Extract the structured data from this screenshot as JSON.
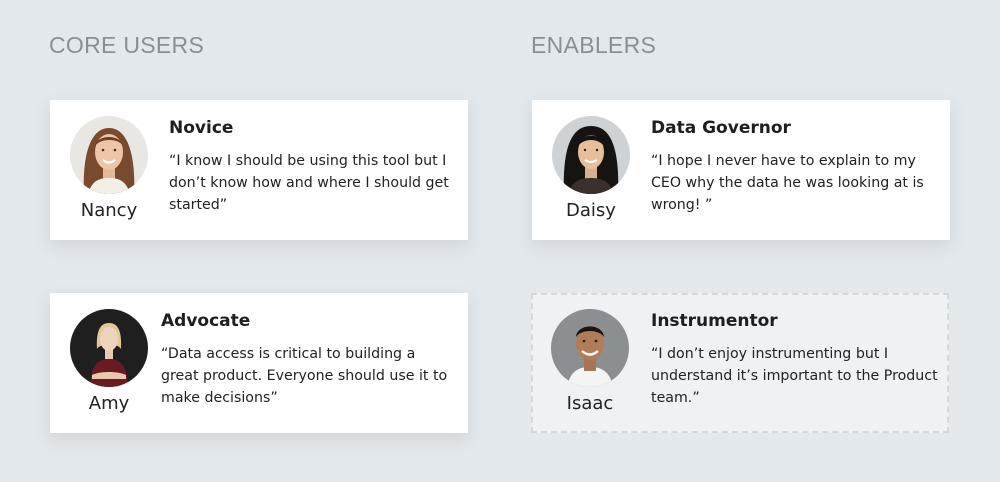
{
  "sections": {
    "core_users": "CORE USERS",
    "enablers": "ENABLERS"
  },
  "personas": [
    {
      "name": "Nancy",
      "role": "Novice",
      "quote": "“I know I should be using this tool but I don’t know how and where I should get started”"
    },
    {
      "name": "Amy",
      "role": "Advocate",
      "quote": "“Data access is critical to building a great product. Everyone should use it to make decisions”"
    },
    {
      "name": "Daisy",
      "role": "Data Governor",
      "quote": "“I hope I never have to explain to my CEO why the data he was looking at is wrong! ”"
    },
    {
      "name": "Isaac",
      "role": "Instrumentor",
      "quote": "“I don’t enjoy instrumenting but I understand it’s important to the Product team.”"
    }
  ],
  "colors": {
    "background": "#e3e8ec",
    "section_title": "#8a8f95",
    "card": "#ffffff",
    "card_dashed": "#eef2f4"
  }
}
